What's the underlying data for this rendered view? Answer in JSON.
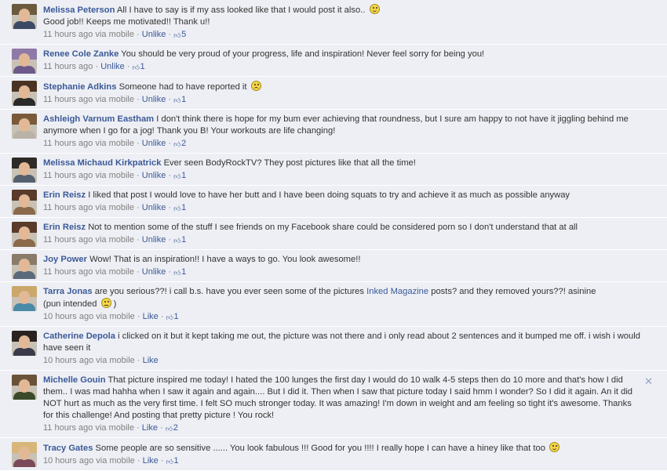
{
  "comments": [
    {
      "author": "Melissa Peterson",
      "text": "All I have to say is if my ass looked like that I would post it also..",
      "emoji": "smile",
      "text2": "Good job!! Keeps me motivated!! Thank u!!",
      "time": "11 hours ago via mobile",
      "action": "Unlike",
      "likes": "5",
      "avatar_colors": {
        "hair": "#6b5a3e",
        "body": "#3c4a66"
      }
    },
    {
      "author": "Renee Cole Zanke",
      "text": "You should be very proud of your progress, life and inspiration! Never feel sorry for being you!",
      "time": "11 hours ago",
      "action": "Unlike",
      "likes": "1",
      "avatar_colors": {
        "hair": "#8e79a8",
        "body": "#6d5a8a"
      }
    },
    {
      "author": "Stephanie Adkins",
      "text": "Someone had to have reported it",
      "emoji": "sad",
      "time": "11 hours ago via mobile",
      "action": "Unlike",
      "likes": "1",
      "avatar_colors": {
        "hair": "#4a3322",
        "body": "#2a2a2a"
      }
    },
    {
      "author": "Ashleigh Varnum Eastham",
      "text": "I don't think there is hope for my bum ever achieving that roundness, but I sure am happy to not have it jiggling behind me anymore when I go for a jog! Thank you B! Your workouts are life changing!",
      "time": "11 hours ago via mobile",
      "action": "Unlike",
      "likes": "2",
      "avatar_colors": {
        "hair": "#7a5a3a",
        "body": "#b9b2a6"
      }
    },
    {
      "author": "Melissa Michaud Kirkpatrick",
      "text": "Ever seen BodyRockTV? They post pictures like that all the time!",
      "time": "11 hours ago via mobile",
      "action": "Unlike",
      "likes": "1",
      "avatar_colors": {
        "hair": "#2e2a26",
        "body": "#55606e"
      }
    },
    {
      "author": "Erin Reisz",
      "text": "I liked that post I would love to have her butt and I have been doing squats to try and achieve it as much as possible anyway",
      "time": "11 hours ago via mobile",
      "action": "Unlike",
      "likes": "1",
      "avatar_colors": {
        "hair": "#5a3a2a",
        "body": "#8a6a4a"
      }
    },
    {
      "author": "Erin Reisz",
      "text": "Not to mention some of the stuff I see friends on my Facebook share could be considered porn so I don't understand that at all",
      "time": "11 hours ago via mobile",
      "action": "Unlike",
      "likes": "1",
      "avatar_colors": {
        "hair": "#5a3a2a",
        "body": "#8a6a4a"
      }
    },
    {
      "author": "Joy Power",
      "text": "Wow! That is an inspiration!! I have a ways to go. You look awesome!!",
      "time": "11 hours ago via mobile",
      "action": "Unlike",
      "likes": "1",
      "avatar_colors": {
        "hair": "#8a7a6a",
        "body": "#5a6a7a"
      }
    },
    {
      "author": "Tarra Jonas",
      "text": "are you serious??! i call b.s. have you ever seen some of the pictures",
      "link": "Inked Magazine",
      "text_after": "posts? and they removed yours??! asinine",
      "text2": "(pun intended",
      "emoji2": "neutral",
      "text2_end": ")",
      "time": "10 hours ago via mobile",
      "action": "Like",
      "likes": "1",
      "avatar_colors": {
        "hair": "#c9a86a",
        "body": "#4a8aa8"
      }
    },
    {
      "author": "Catherine Depola",
      "text": "i clicked on it but it kept taking me out, the picture was not there and i only read about 2 sentences and it bumped me off. i wish i would have seen it",
      "time": "10 hours ago via mobile",
      "action": "Like",
      "avatar_colors": {
        "hair": "#2a2220",
        "body": "#3a3a4a"
      }
    },
    {
      "author": "Michelle Gouin",
      "text": "That picture inspired me today! I hated the 100 lunges the first day I would do 10 walk 4-5 steps then do 10 more and that's how I did them.. I was mad hahha when I saw it again and again.... But I did it. Then when I saw that picture today I said hmm I wonder? So I did it again. An it did NOT hurt as much as the very first time. I felt SO much stronger today. It was amazing! I'm down in weight and am feeling so tight it's awesome. Thanks for this challenge! And posting that pretty picture ! You rock!",
      "time": "11 hours ago via mobile",
      "action": "Like",
      "likes": "2",
      "close": "✕",
      "avatar_colors": {
        "hair": "#6a5238",
        "body": "#3a4a2a"
      }
    },
    {
      "author": "Tracy Gates",
      "text": "Some people are so sensitive ...... You look fabulous !!! Good for you !!!! I really hope I can have a hiney like that too",
      "emoji": "smile",
      "time": "10 hours ago via mobile",
      "action": "Like",
      "likes": "1",
      "avatar_colors": {
        "hair": "#d8b67a",
        "body": "#7a4a5a"
      }
    }
  ]
}
